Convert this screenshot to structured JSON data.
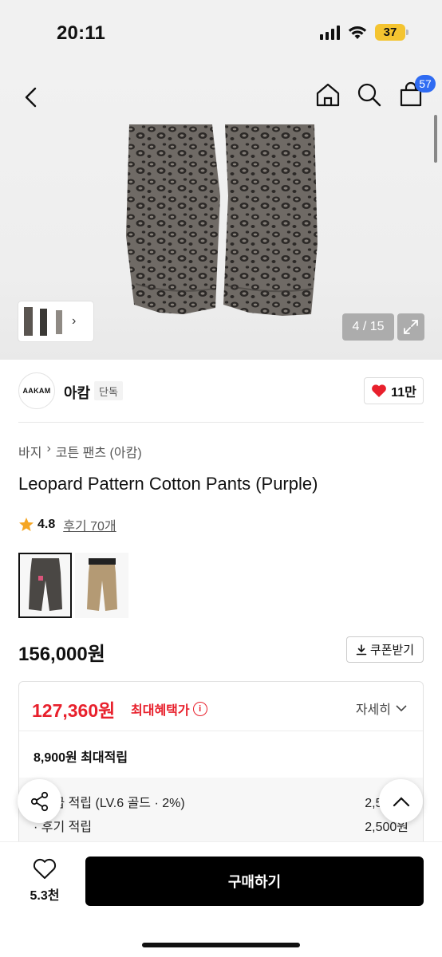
{
  "status_bar": {
    "time": "20:11",
    "battery": "37"
  },
  "nav": {
    "cart_count": "57"
  },
  "gallery": {
    "counter": "4 / 15"
  },
  "brand": {
    "logo_text": "AAKAM",
    "name": "아캄",
    "tag": "단독",
    "likes": "11만"
  },
  "breadcrumb": [
    "바지",
    "코튼 팬츠 (아캄)"
  ],
  "product": {
    "title": "Leopard Pattern Cotton Pants (Purple)",
    "rating": "4.8",
    "reviews": "후기 70개",
    "price": "156,000원",
    "coupon_label": "쿠폰받기"
  },
  "benefit": {
    "max_price": "127,360원",
    "max_price_label": "최대혜택가",
    "detail_label": "자세히",
    "max_points": "8,900원 최대적립",
    "rows": [
      {
        "label": "· 등급 적립 (LV.6 골드 · 2%)",
        "value": "2,500원"
      },
      {
        "label": "· 후기 적립",
        "value": "2,500원"
      }
    ]
  },
  "bottom": {
    "wish_count": "5.3천",
    "buy_label": "구매하기"
  },
  "colors": {
    "accent_red": "#e8202c",
    "badge_blue": "#2f6bf2"
  }
}
